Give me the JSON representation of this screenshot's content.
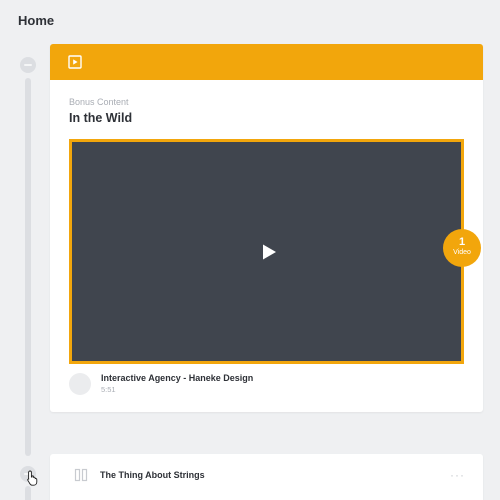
{
  "page": {
    "title": "Home"
  },
  "card": {
    "eyebrow": "Bonus Content",
    "title": "In the Wild",
    "badge": {
      "count": "1",
      "label": "Video"
    },
    "video": {
      "name": "Interactive Agency - Haneke Design",
      "duration": "5:51"
    }
  },
  "next_item": {
    "title": "The Thing About Strings",
    "more": "···"
  },
  "colors": {
    "accent": "#f2a60c",
    "player": "#40454e",
    "background": "#eff0f2"
  },
  "icons": {
    "header": "media-icon",
    "play": "play-icon",
    "module": "module-icon",
    "more": "more-icon"
  }
}
